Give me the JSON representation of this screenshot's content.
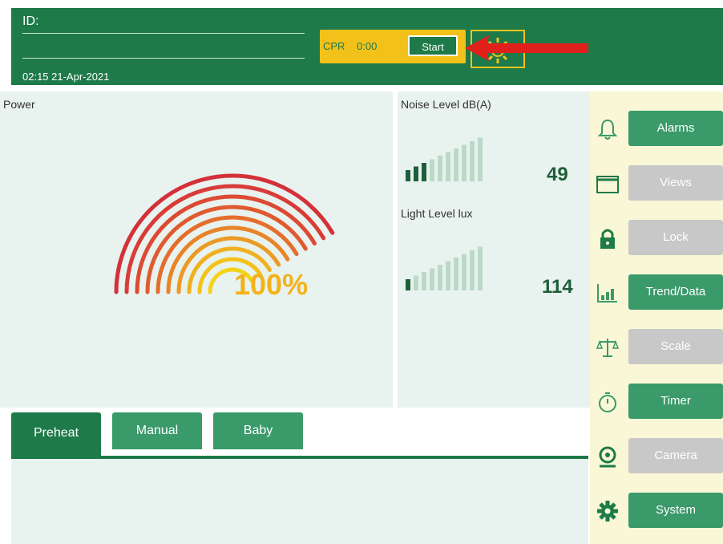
{
  "header": {
    "id_label": "ID:",
    "datetime": "02:15 21-Apr-2021",
    "cpr_label": "CPR",
    "cpr_time": "0:00",
    "start_label": "Start"
  },
  "power": {
    "title": "Power",
    "value": "100%"
  },
  "noise": {
    "title": "Noise Level dB(A)",
    "value": "49",
    "level_bars": 3,
    "total_bars": 10
  },
  "light": {
    "title": "Light Level lux",
    "value": "114",
    "level_bars": 1,
    "total_bars": 10
  },
  "tabs": [
    {
      "label": "Preheat",
      "active": true
    },
    {
      "label": "Manual",
      "active": false
    },
    {
      "label": "Baby",
      "active": false
    }
  ],
  "sidebar": {
    "items": [
      {
        "label": "Alarms",
        "icon": "bell-icon",
        "enabled": true
      },
      {
        "label": "Views",
        "icon": "window-icon",
        "enabled": false
      },
      {
        "label": "Lock",
        "icon": "lock-icon",
        "enabled": false
      },
      {
        "label": "Trend/Data",
        "icon": "bar-chart-icon",
        "enabled": true
      },
      {
        "label": "Scale",
        "icon": "scale-icon",
        "enabled": false
      },
      {
        "label": "Timer",
        "icon": "stopwatch-icon",
        "enabled": true
      },
      {
        "label": "Camera",
        "icon": "camera-icon",
        "enabled": false
      },
      {
        "label": "System",
        "icon": "gear-icon",
        "enabled": true
      }
    ]
  },
  "colors": {
    "primary": "#1e7a49",
    "accent": "#f3c21a",
    "arrow": "#e0201a"
  }
}
